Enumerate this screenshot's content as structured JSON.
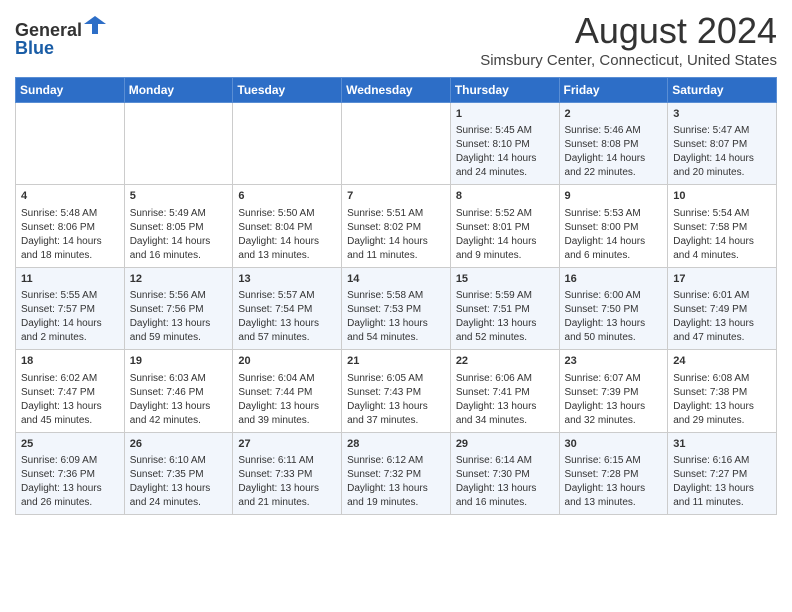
{
  "header": {
    "logo_line1": "General",
    "logo_line2": "Blue",
    "month_title": "August 2024",
    "location": "Simsbury Center, Connecticut, United States"
  },
  "days_of_week": [
    "Sunday",
    "Monday",
    "Tuesday",
    "Wednesday",
    "Thursday",
    "Friday",
    "Saturday"
  ],
  "weeks": [
    [
      {
        "day": "",
        "content": ""
      },
      {
        "day": "",
        "content": ""
      },
      {
        "day": "",
        "content": ""
      },
      {
        "day": "",
        "content": ""
      },
      {
        "day": "1",
        "content": "Sunrise: 5:45 AM\nSunset: 8:10 PM\nDaylight: 14 hours\nand 24 minutes."
      },
      {
        "day": "2",
        "content": "Sunrise: 5:46 AM\nSunset: 8:08 PM\nDaylight: 14 hours\nand 22 minutes."
      },
      {
        "day": "3",
        "content": "Sunrise: 5:47 AM\nSunset: 8:07 PM\nDaylight: 14 hours\nand 20 minutes."
      }
    ],
    [
      {
        "day": "4",
        "content": "Sunrise: 5:48 AM\nSunset: 8:06 PM\nDaylight: 14 hours\nand 18 minutes."
      },
      {
        "day": "5",
        "content": "Sunrise: 5:49 AM\nSunset: 8:05 PM\nDaylight: 14 hours\nand 16 minutes."
      },
      {
        "day": "6",
        "content": "Sunrise: 5:50 AM\nSunset: 8:04 PM\nDaylight: 14 hours\nand 13 minutes."
      },
      {
        "day": "7",
        "content": "Sunrise: 5:51 AM\nSunset: 8:02 PM\nDaylight: 14 hours\nand 11 minutes."
      },
      {
        "day": "8",
        "content": "Sunrise: 5:52 AM\nSunset: 8:01 PM\nDaylight: 14 hours\nand 9 minutes."
      },
      {
        "day": "9",
        "content": "Sunrise: 5:53 AM\nSunset: 8:00 PM\nDaylight: 14 hours\nand 6 minutes."
      },
      {
        "day": "10",
        "content": "Sunrise: 5:54 AM\nSunset: 7:58 PM\nDaylight: 14 hours\nand 4 minutes."
      }
    ],
    [
      {
        "day": "11",
        "content": "Sunrise: 5:55 AM\nSunset: 7:57 PM\nDaylight: 14 hours\nand 2 minutes."
      },
      {
        "day": "12",
        "content": "Sunrise: 5:56 AM\nSunset: 7:56 PM\nDaylight: 13 hours\nand 59 minutes."
      },
      {
        "day": "13",
        "content": "Sunrise: 5:57 AM\nSunset: 7:54 PM\nDaylight: 13 hours\nand 57 minutes."
      },
      {
        "day": "14",
        "content": "Sunrise: 5:58 AM\nSunset: 7:53 PM\nDaylight: 13 hours\nand 54 minutes."
      },
      {
        "day": "15",
        "content": "Sunrise: 5:59 AM\nSunset: 7:51 PM\nDaylight: 13 hours\nand 52 minutes."
      },
      {
        "day": "16",
        "content": "Sunrise: 6:00 AM\nSunset: 7:50 PM\nDaylight: 13 hours\nand 50 minutes."
      },
      {
        "day": "17",
        "content": "Sunrise: 6:01 AM\nSunset: 7:49 PM\nDaylight: 13 hours\nand 47 minutes."
      }
    ],
    [
      {
        "day": "18",
        "content": "Sunrise: 6:02 AM\nSunset: 7:47 PM\nDaylight: 13 hours\nand 45 minutes."
      },
      {
        "day": "19",
        "content": "Sunrise: 6:03 AM\nSunset: 7:46 PM\nDaylight: 13 hours\nand 42 minutes."
      },
      {
        "day": "20",
        "content": "Sunrise: 6:04 AM\nSunset: 7:44 PM\nDaylight: 13 hours\nand 39 minutes."
      },
      {
        "day": "21",
        "content": "Sunrise: 6:05 AM\nSunset: 7:43 PM\nDaylight: 13 hours\nand 37 minutes."
      },
      {
        "day": "22",
        "content": "Sunrise: 6:06 AM\nSunset: 7:41 PM\nDaylight: 13 hours\nand 34 minutes."
      },
      {
        "day": "23",
        "content": "Sunrise: 6:07 AM\nSunset: 7:39 PM\nDaylight: 13 hours\nand 32 minutes."
      },
      {
        "day": "24",
        "content": "Sunrise: 6:08 AM\nSunset: 7:38 PM\nDaylight: 13 hours\nand 29 minutes."
      }
    ],
    [
      {
        "day": "25",
        "content": "Sunrise: 6:09 AM\nSunset: 7:36 PM\nDaylight: 13 hours\nand 26 minutes."
      },
      {
        "day": "26",
        "content": "Sunrise: 6:10 AM\nSunset: 7:35 PM\nDaylight: 13 hours\nand 24 minutes."
      },
      {
        "day": "27",
        "content": "Sunrise: 6:11 AM\nSunset: 7:33 PM\nDaylight: 13 hours\nand 21 minutes."
      },
      {
        "day": "28",
        "content": "Sunrise: 6:12 AM\nSunset: 7:32 PM\nDaylight: 13 hours\nand 19 minutes."
      },
      {
        "day": "29",
        "content": "Sunrise: 6:14 AM\nSunset: 7:30 PM\nDaylight: 13 hours\nand 16 minutes."
      },
      {
        "day": "30",
        "content": "Sunrise: 6:15 AM\nSunset: 7:28 PM\nDaylight: 13 hours\nand 13 minutes."
      },
      {
        "day": "31",
        "content": "Sunrise: 6:16 AM\nSunset: 7:27 PM\nDaylight: 13 hours\nand 11 minutes."
      }
    ]
  ]
}
